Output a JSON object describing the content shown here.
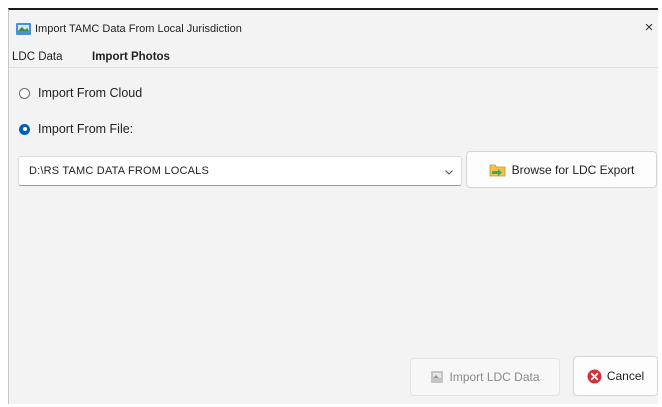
{
  "window": {
    "title": "Import TAMC Data From Local Jurisdiction",
    "close_glyph": "×"
  },
  "tabs": [
    {
      "label": "LDC Data",
      "active": true
    },
    {
      "label": "Import Photos",
      "active": false
    }
  ],
  "options": {
    "cloud": {
      "label": "Import From Cloud",
      "selected": false
    },
    "file": {
      "label": "Import From File:",
      "selected": true
    }
  },
  "file_path": {
    "value": "D:\\RS TAMC DATA FROM LOCALS"
  },
  "buttons": {
    "browse": {
      "label": "Browse for LDC Export",
      "icon": "folder-icon"
    },
    "import": {
      "label": "Import LDC Data",
      "icon": "import-icon",
      "enabled": false
    },
    "cancel": {
      "label": "Cancel",
      "icon": "cancel-icon"
    }
  },
  "colors": {
    "accent": "#005fb8",
    "cancel_red": "#d13438",
    "folder_yellow": "#f2c14e",
    "arrow_green": "#3fae49"
  }
}
